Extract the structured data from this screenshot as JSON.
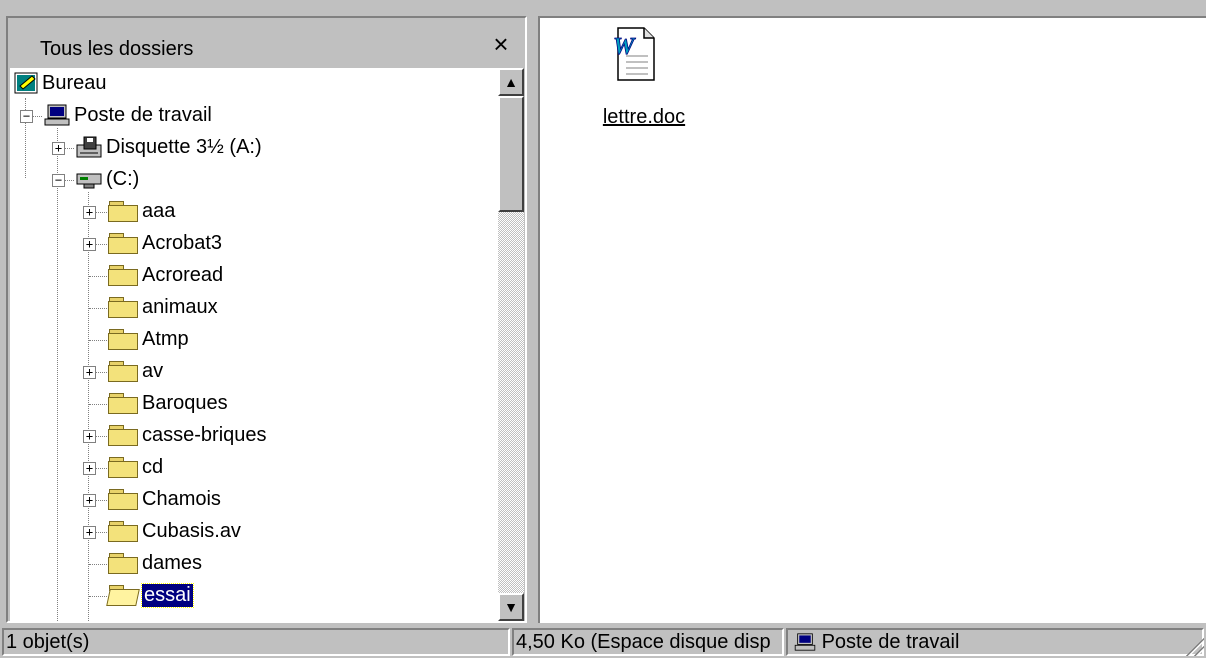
{
  "left_pane": {
    "title": "Tous les dossiers",
    "close_label": "×"
  },
  "tree": {
    "desktop": "Bureau",
    "computer": "Poste de travail",
    "floppy": "Disquette 3½ (A:)",
    "drive_c": "(C:)",
    "folders": [
      {
        "label": "aaa",
        "expandable": true
      },
      {
        "label": "Acrobat3",
        "expandable": true
      },
      {
        "label": "Acroread",
        "expandable": false
      },
      {
        "label": "animaux",
        "expandable": false
      },
      {
        "label": "Atmp",
        "expandable": false
      },
      {
        "label": "av",
        "expandable": true
      },
      {
        "label": "Baroques",
        "expandable": false
      },
      {
        "label": "casse-briques",
        "expandable": true
      },
      {
        "label": "cd",
        "expandable": true
      },
      {
        "label": "Chamois",
        "expandable": true
      },
      {
        "label": "Cubasis.av",
        "expandable": true
      },
      {
        "label": "dames",
        "expandable": false
      },
      {
        "label": "essai",
        "expandable": false,
        "selected": true
      }
    ]
  },
  "right_pane": {
    "files": [
      {
        "name": "lettre.doc",
        "icon": "word-document-icon"
      }
    ]
  },
  "status_bar": {
    "objects": "1 objet(s)",
    "size": "4,50 Ko (Espace disque disp",
    "location": "Poste de travail"
  },
  "colors": {
    "face": "#c0c0c0",
    "selection": "#000080",
    "folder": "#f3e27b"
  }
}
